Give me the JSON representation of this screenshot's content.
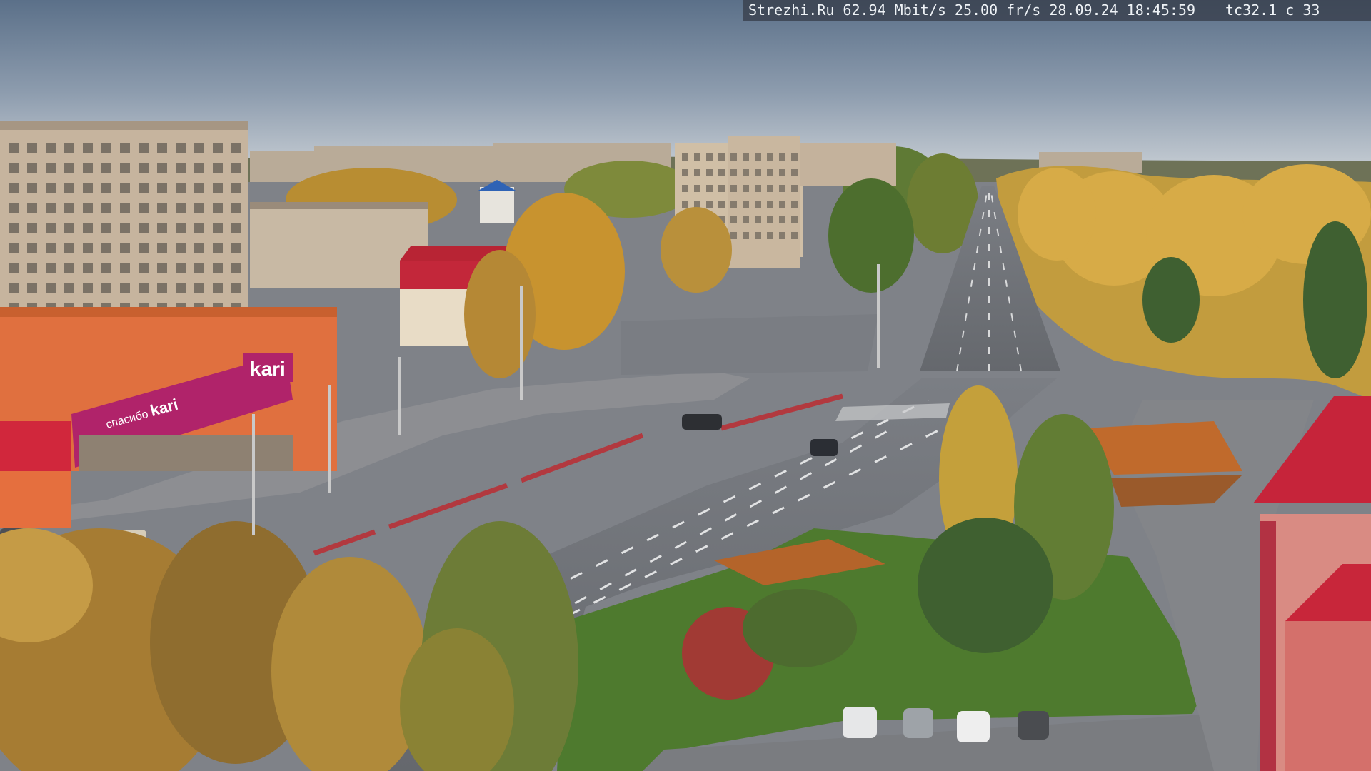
{
  "overlay": {
    "site": "Strezhi.Ru",
    "bitrate": "62.94 Mbit/s",
    "framerate": "25.00 fr/s",
    "date": "28.09.24",
    "time": "18:45:59",
    "camera_code": "tc32.1",
    "channel": "c 33"
  },
  "signs": {
    "store_brand": "kari",
    "store_slogan_1": "спасибо",
    "store_slogan_2": "kari"
  },
  "colors": {
    "sky_top": "#5f7690",
    "sky_horizon": "#c3cbd3",
    "road": "#6f7277",
    "pavement": "#8a8d92",
    "grass": "#4f7a2e",
    "foliage_gold": "#c99a3c",
    "brick_panel": "#c9b8a3",
    "store_orange": "#e0703f",
    "store_magenta": "#b0236a",
    "roof_red": "#c3273a"
  }
}
